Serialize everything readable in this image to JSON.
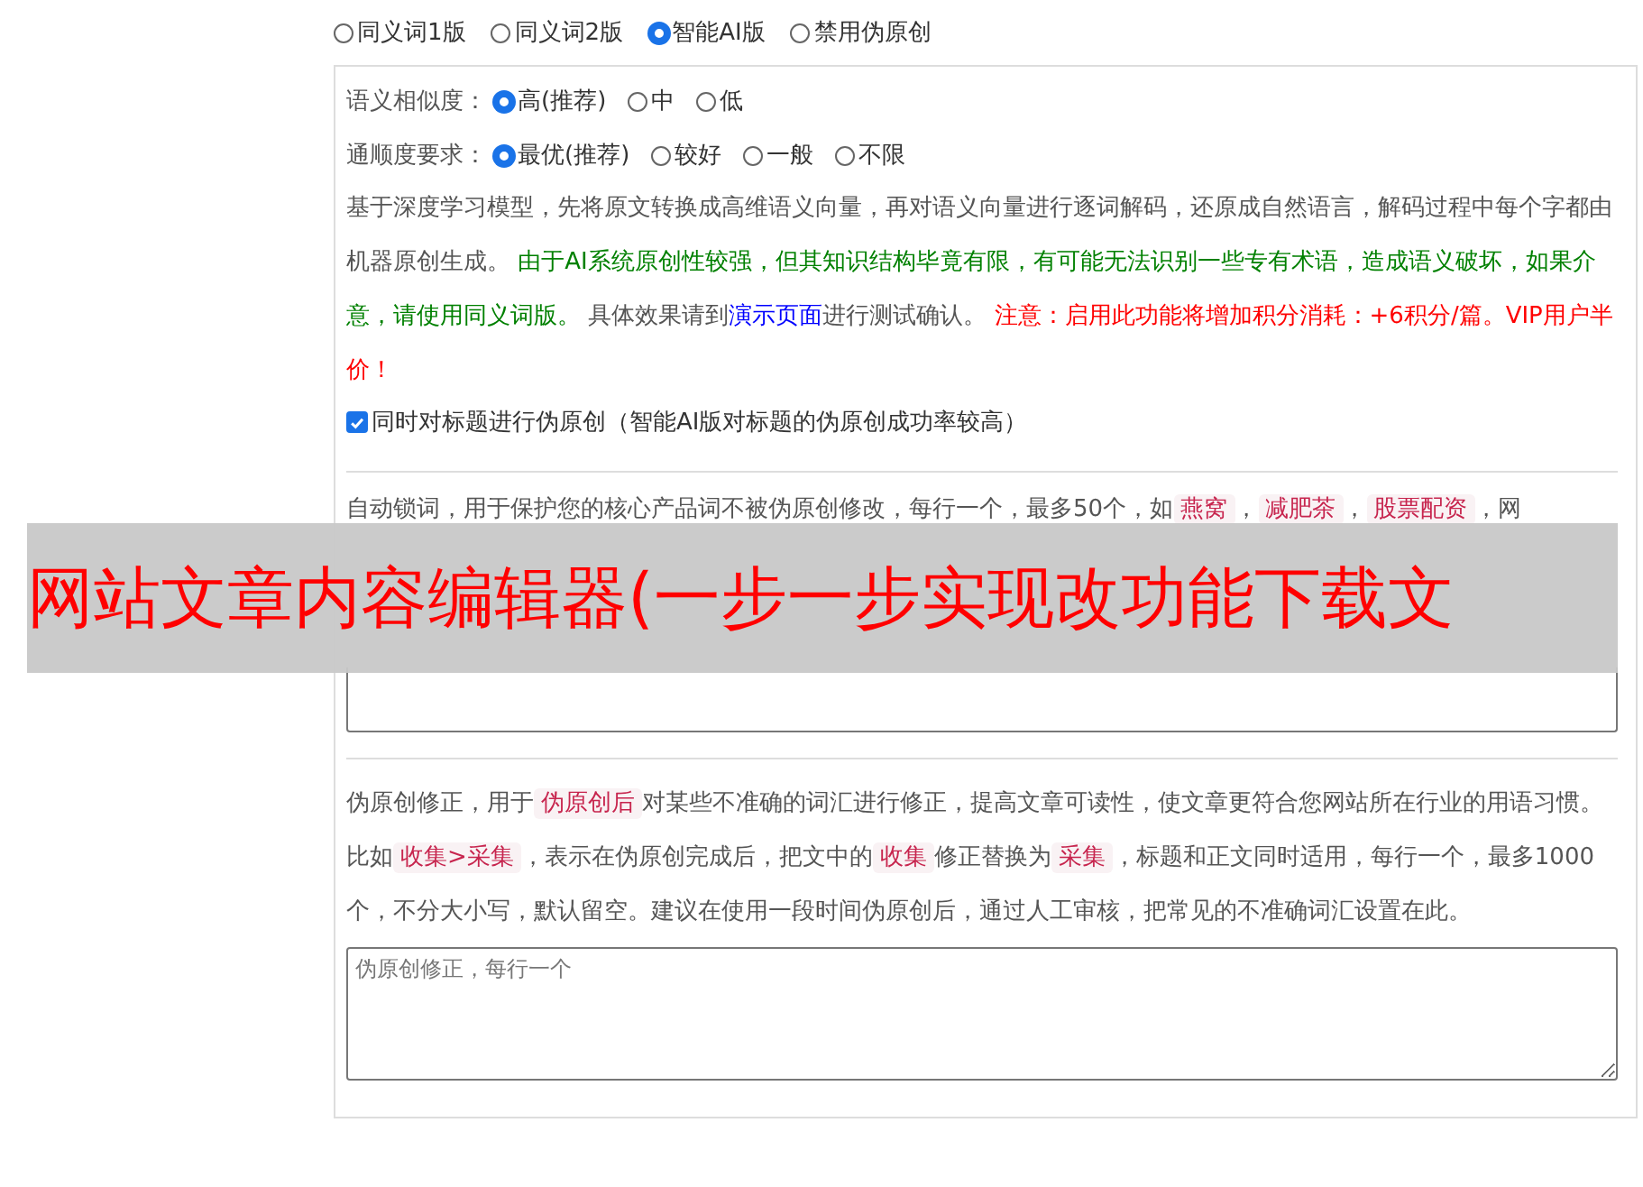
{
  "mode_options": [
    {
      "label": "同义词1版",
      "selected": false
    },
    {
      "label": "同义词2版",
      "selected": false
    },
    {
      "label": "智能AI版",
      "selected": true
    },
    {
      "label": "禁用伪原创",
      "selected": false
    }
  ],
  "similarity": {
    "label": "语义相似度：",
    "options": [
      {
        "label": "高(推荐)",
        "selected": true
      },
      {
        "label": "中",
        "selected": false
      },
      {
        "label": "低",
        "selected": false
      }
    ]
  },
  "fluency": {
    "label": "通顺度要求：",
    "options": [
      {
        "label": "最优(推荐)",
        "selected": true
      },
      {
        "label": "较好",
        "selected": false
      },
      {
        "label": "一般",
        "selected": false
      },
      {
        "label": "不限",
        "selected": false
      }
    ]
  },
  "ai_description": [
    {
      "kind": "text",
      "text": "基于深度学习模型，先将原文转换成高维语义向量，再对语义向量进行逐词解码，还原成自然语言，解码过程中每个字都由机器原创生成。 "
    },
    {
      "kind": "note",
      "text": "由于AI系统原创性较强，但其知识结构毕竟有限，有可能无法识别一些专有术语，造成语义破坏，如果介意，请使用同义词版。"
    },
    {
      "kind": "text",
      "text": " 具体效果请到"
    },
    {
      "kind": "link",
      "text": "演示页面"
    },
    {
      "kind": "text",
      "text": "进行测试确认。 "
    },
    {
      "kind": "warning",
      "text": "注意：启用此功能将增加积分消耗：+6积分/篇。VIP用户半价！"
    }
  ],
  "title_option": {
    "label": "同时对标题进行伪原创（智能AI版对标题的伪原创成功率较高）",
    "checked": true
  },
  "lock_words": {
    "description": [
      {
        "kind": "text",
        "text": "自动锁词，用于保护您的核心产品词不被伪原创修改，每行一个，最多50个，如"
      },
      {
        "kind": "code",
        "text": "燕窝"
      },
      {
        "kind": "text",
        "text": "，"
      },
      {
        "kind": "code",
        "text": "减肥茶"
      },
      {
        "kind": "text",
        "text": "，"
      },
      {
        "kind": "code",
        "text": "股票配资"
      },
      {
        "kind": "text",
        "text": "，网"
      }
    ]
  },
  "correction": {
    "description": [
      {
        "kind": "text",
        "text": "伪原创修正，用于"
      },
      {
        "kind": "code",
        "text": "伪原创后"
      },
      {
        "kind": "text",
        "text": "对某些不准确的词汇进行修正，提高文章可读性，使文章更符合您网站所在行业的用语习惯。比如"
      },
      {
        "kind": "code",
        "text": "收集>采集"
      },
      {
        "kind": "text",
        "text": "，表示在伪原创完成后，把文中的"
      },
      {
        "kind": "code",
        "text": "收集"
      },
      {
        "kind": "text",
        "text": "修正替换为"
      },
      {
        "kind": "code",
        "text": "采集"
      },
      {
        "kind": "text",
        "text": "，标题和正文同时适用，每行一个，最多1000个，不分大小写，默认留空。建议在使用一段时间伪原创后，通过人工审核，把常见的不准确词汇设置在此。"
      }
    ],
    "placeholder": "伪原创修正，每行一个"
  },
  "overlay_banner": {
    "text": "网站文章内容编辑器(一步一步实现改功能下载文"
  }
}
